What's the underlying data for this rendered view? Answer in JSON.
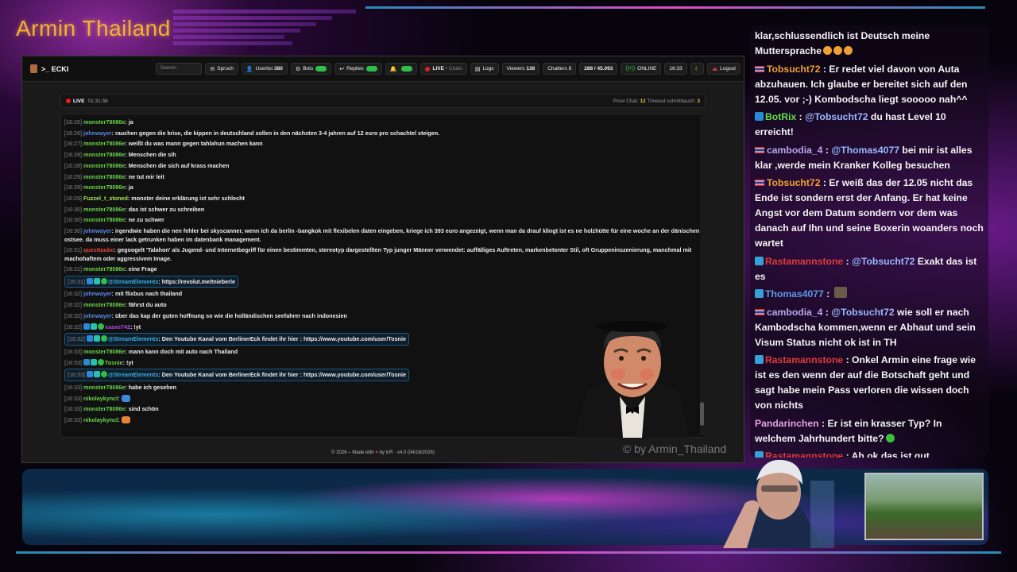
{
  "overlay": {
    "title": "Armin Thailand",
    "watermark": "© by Armin_Thailand"
  },
  "nav": {
    "brand": ">_ ECKI",
    "search_placeholder": "Search...",
    "spruch": "Spruch",
    "userlist_label": "Userlist",
    "userlist_count": "380",
    "bots": "Bots",
    "replies": "Replies",
    "live": "LIVE",
    "chats": "• Chats",
    "logs": "Logs",
    "viewers_label": "Viewers",
    "viewers_count": "138",
    "chatters": "Chatters 8",
    "counter": "288 / 45.093",
    "online": "ONLINE",
    "time": "16:33",
    "logout": "Logout"
  },
  "livebar": {
    "live": "LIVE",
    "duration": "01:31:38",
    "right_prefix": "Proxi Chat:",
    "proxi_count": "12",
    "timeout_label": "Timeout schnittlauch:",
    "timeout_count": "3"
  },
  "chatlog": [
    {
      "ts": "[16:26]",
      "user": "monster78086e",
      "color": "green",
      "msg": "ja"
    },
    {
      "ts": "[16:26]",
      "user": "johnwayer",
      "color": "blue",
      "msg": "rauchen gegen die krise, die kippen in deutschland sollen in den nächsten 3-4 jahren auf 12 euro pro schachtel steigen."
    },
    {
      "ts": "[16:27]",
      "user": "monster78086e",
      "color": "green",
      "msg": "weißt du was mann gegen tahlahun machen kann"
    },
    {
      "ts": "[16:28]",
      "user": "monster78086e",
      "color": "green",
      "msg": "Menschen die sih"
    },
    {
      "ts": "[16:28]",
      "user": "monster78086e",
      "color": "green",
      "msg": "Menschen die sich auf krass machen"
    },
    {
      "ts": "[16:29]",
      "user": "monster78086e",
      "color": "green",
      "msg": "ne tut mir leit"
    },
    {
      "ts": "[16:29]",
      "user": "monster78086e",
      "color": "green",
      "msg": "ja"
    },
    {
      "ts": "[16:29]",
      "user": "Fuzzel_t_stoned",
      "color": "lime",
      "msg": "monster deine erklärung ist sehr schlecht"
    },
    {
      "ts": "[16:30]",
      "user": "monster78086e",
      "color": "green",
      "msg": "das ist schwer zu schreiben"
    },
    {
      "ts": "[16:30]",
      "user": "monster78086e",
      "color": "green",
      "msg": "ne zu schwer"
    },
    {
      "ts": "[16:30]",
      "user": "johnwayer",
      "color": "blue",
      "msg": "irgendwie haben die nen fehler bei skyscanner, wenn ich da berlin -bangkok mit flexibelen daten eingeben, kriege ich 393 euro angezeigt, wenn man da drauf klingt ist es ne holzhütte für eine woche an der dänischen ostsee. da muss einer lack getrunken haben im datenbank management.",
      "wrap": true
    },
    {
      "ts": "[16:31]",
      "user": "questtaube",
      "color": "red",
      "msg": "gegoogelt 'Talahon' als Jugend- und Internetbegriff für einen bestimmten, stereotyp dargestellten Typ junger Männer verwendet: auffälliges Auftreten, markenbetonter Stil, oft Gruppeninszenierung, manchmal mit machohaftem oder aggressivem Image.",
      "wrap": true
    },
    {
      "ts": "[16:31]",
      "user": "monster78086e",
      "color": "green",
      "msg": "eine Frage"
    },
    {
      "ts": "[16:31]",
      "user": "@StreamElements",
      "color": "cyan",
      "msg": "https://revolut.me/tnieberle",
      "highlight": true
    },
    {
      "ts": "[16:32]",
      "user": "johnwayer",
      "color": "blue",
      "msg": "mit flixbus nach thailand"
    },
    {
      "ts": "[16:32]",
      "user": "monster78086e",
      "color": "green",
      "msg": "fährst du auto"
    },
    {
      "ts": "[16:32]",
      "user": "johnwayer",
      "color": "blue",
      "msg": "über das kap der guten hoffnung so wie die holländischen seefahrer nach indonesien"
    },
    {
      "ts": "[16:32]",
      "user": "xxaxe742",
      "color": "purple",
      "msg": "!yt"
    },
    {
      "ts": "[16:32]",
      "user": "@StreamElements",
      "color": "cyan",
      "msg": "Den Youtube Kanal vom BerlinerEck findet ihr hier : https://www.youtube.com/user/Tosnie",
      "highlight": true
    },
    {
      "ts": "[16:33]",
      "user": "monster78086e",
      "color": "green",
      "msg": "mann kann doch mit auto nach Thailand"
    },
    {
      "ts": "[16:33]",
      "user": "Tosnie",
      "color": "green",
      "msg": "!yt"
    },
    {
      "ts": "[16:33]",
      "user": "@StreamElements",
      "color": "cyan",
      "msg": "Den Youtube Kanal vom BerlinerEck findet ihr hier : https://www.youtube.com/user/Tosnie",
      "highlight": true
    },
    {
      "ts": "[16:33]",
      "user": "monster78086e",
      "color": "green",
      "msg": "habe ich gesehen"
    },
    {
      "ts": "[16:33]",
      "user": "nikolaykyncl",
      "color": "green",
      "msg": ""
    },
    {
      "ts": "[16:33]",
      "user": "monster78086e",
      "color": "green",
      "msg": "sind schön"
    },
    {
      "ts": "[16:33]",
      "user": "nikolaykyncl",
      "color": "green",
      "msg": ""
    }
  ],
  "footer": {
    "prefix": "© 2026 – Made with",
    "suffix": "by tcR · v4.0 (04/16/2026)"
  },
  "side_chat": [
    {
      "user": "",
      "text": "klar,schlussendlich ist Deutsch meine Muttersprache"
    },
    {
      "user": "Tobsucht72",
      "sep": " : ",
      "text": "Er redet viel davon von Auta abzuhauen. Ich glaube er bereitet sich auf den 12.05. vor ;-) Kombodscha liegt sooooo nah^^"
    },
    {
      "user": "BotRix",
      "sep": " : ",
      "mention": "@Tobsucht72",
      "text": " du hast Level 10 erreicht!"
    },
    {
      "user": "cambodia_4",
      "sep": " : ",
      "mention": "@Thomas4077",
      "text": " bei mir ist alles klar ,werde mein Kranker Kolleg besuchen"
    },
    {
      "user": "Tobsucht72",
      "sep": " : ",
      "text": "Er weiß das der 12.05 nicht das Ende ist sondern erst der Anfang. Er hat keine Angst vor dem Datum sondern vor dem was danach auf Ihn und seine Boxerin woanders noch wartet"
    },
    {
      "user": "Rastamannstone",
      "sep": " : ",
      "mention": "@Tobsucht72",
      "text": " Exakt das ist es"
    },
    {
      "user": "Thomas4077",
      "sep": " : ",
      "text": ""
    },
    {
      "user": "cambodia_4",
      "sep": " : ",
      "mention": "@Tobsucht72",
      "text": " wie soll er nach Kambodscha kommen,wenn er Abhaut und sein Visum Status nicht ok ist in TH"
    },
    {
      "user": "Rastamannstone",
      "sep": " : ",
      "text": "Onkel Armin eine frage wie ist es den wenn der auf die Botschaft geht und sagt habe mein Pass verloren die wissen doch von nichts"
    },
    {
      "user": "Pandarinchen",
      "sep": " : ",
      "text": "Er ist ein krasser Typ? In welchem Jahrhundert bitte?"
    },
    {
      "user": "Rastamannstone",
      "sep": " : ",
      "text": "Ah ok das ist gut"
    }
  ]
}
